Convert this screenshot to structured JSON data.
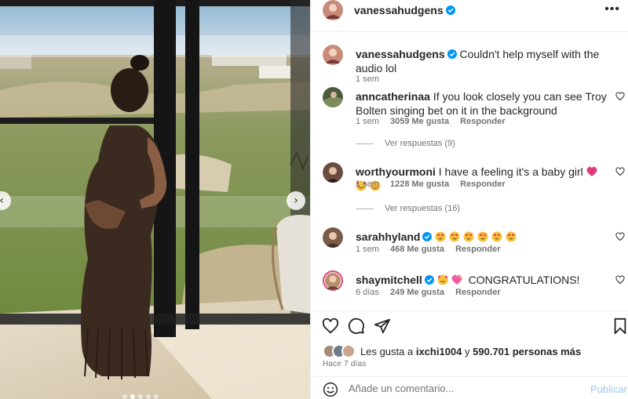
{
  "post": {
    "author": "vanessahudgens",
    "menu_label": "•••",
    "caption": {
      "user": "vanessahudgens",
      "text": "Couldn't help myself with the audio lol",
      "time": "1 sem"
    }
  },
  "carousel": {
    "prev_arrow": "‹",
    "next_arrow": "›",
    "slide_count": 5,
    "active_slide_index": 1
  },
  "comments": [
    {
      "user": "anncatherinaa",
      "text": "If you look closely you can see Troy Bolten singing bet on it in the background",
      "time": "1 sem",
      "likes": "3059 Me gusta",
      "reply": "Responder",
      "view_replies": "Ver respuestas (9)",
      "avatar_color": "#4a5a3a"
    },
    {
      "user": "worthyourmoni",
      "text": "I have a feeling it's a baby girl",
      "time": "1 sem",
      "likes": "1228 Me gusta",
      "reply": "Responder",
      "view_replies": "Ver respuestas (16)",
      "avatar_color": "#6b4b3f"
    },
    {
      "user": "sarahhyland",
      "text": "",
      "time": "1 sem",
      "likes": "468 Me gusta",
      "reply": "Responder",
      "avatar_color": "#7a5b48"
    },
    {
      "user": "shaymitchell",
      "text": "CONGRATULATIONS!",
      "time": "6 días",
      "likes": "249 Me gusta",
      "reply": "Responder",
      "avatar_color": "#b88f6a"
    }
  ],
  "actions": {
    "liked_by_prefix": "Les gusta a",
    "liked_by_user": "ixchi1004",
    "liked_by_connector": "y",
    "liked_by_others": "590.701 personas más",
    "posted_ago": "Hace 7 días"
  },
  "add_comment": {
    "placeholder": "Añade un comentario...",
    "post_label": "Publicar"
  },
  "colors": {
    "verified_blue": "#0095f6",
    "muted_text": "#737373",
    "post_button": "#9bc7f5",
    "heart_pink": "#e33a7a"
  }
}
